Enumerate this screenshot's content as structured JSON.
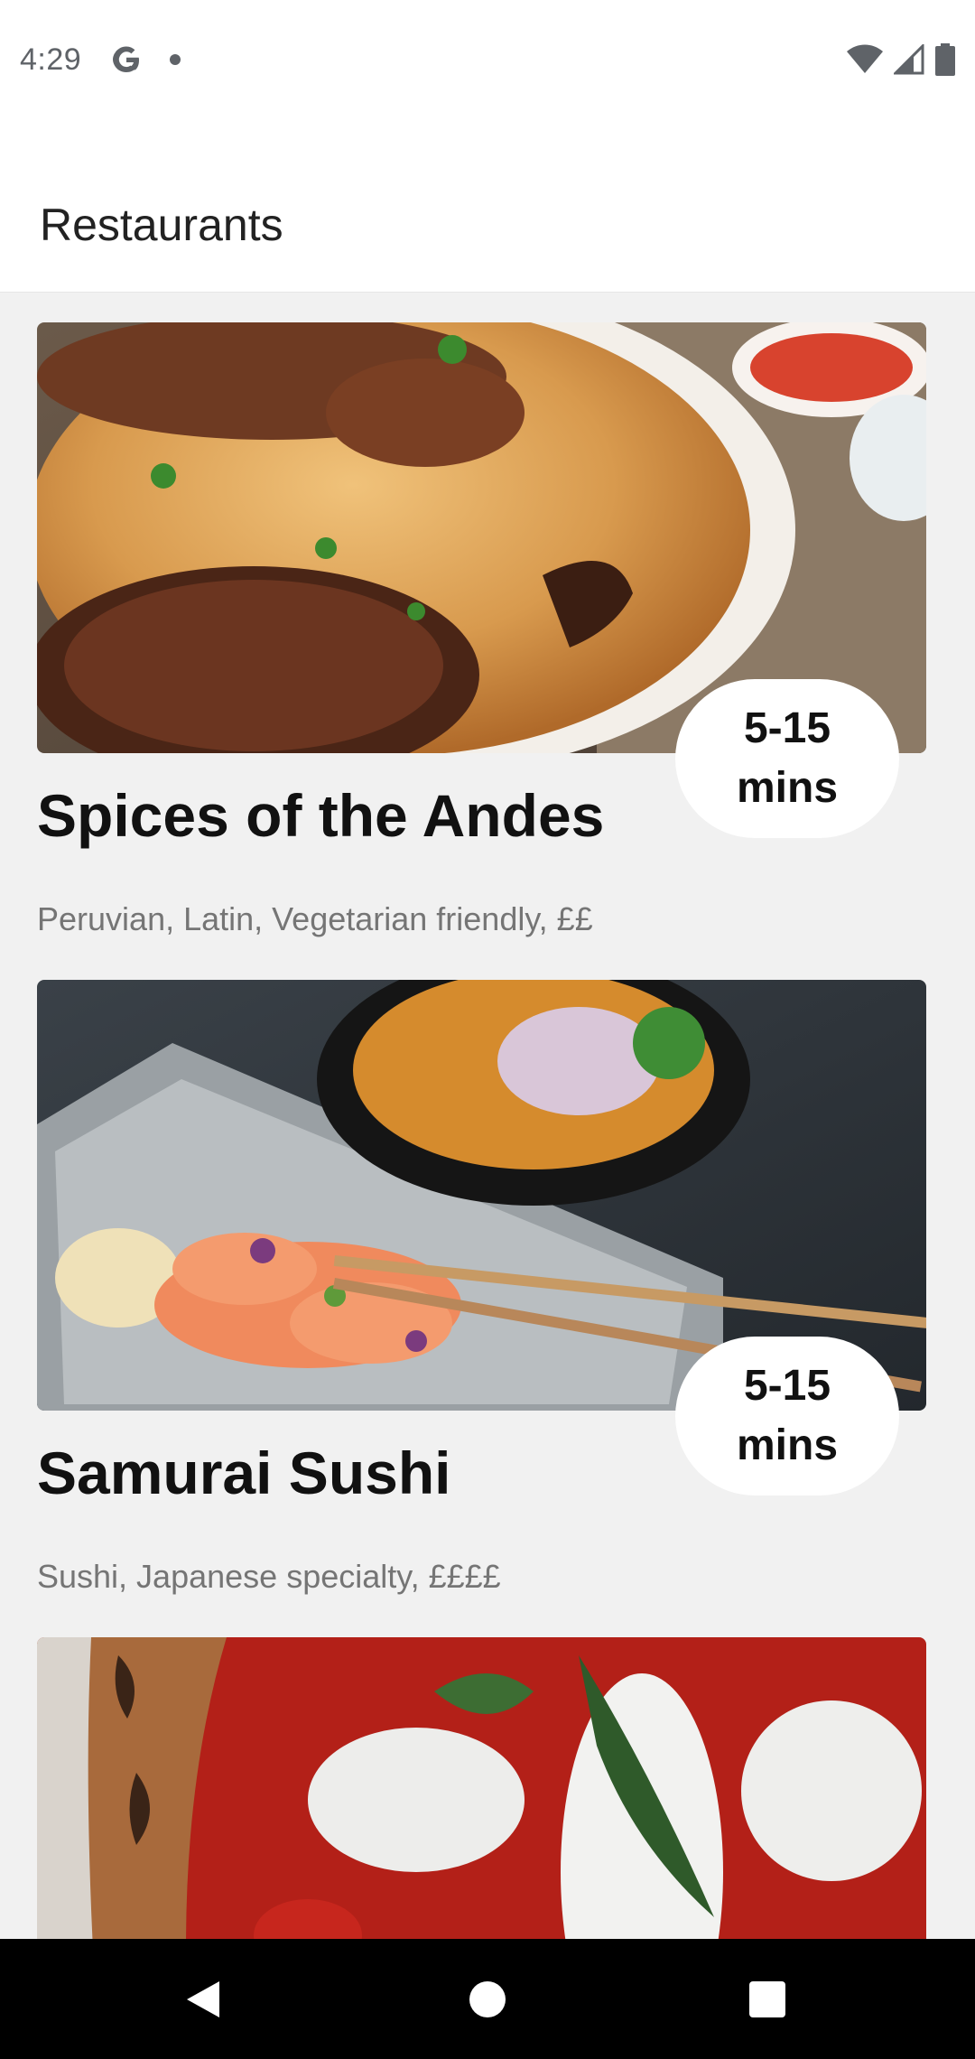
{
  "status_bar": {
    "time": "4:29",
    "icons": [
      "google-icon",
      "notification-dot-icon",
      "wifi-icon",
      "cell-signal-icon",
      "battery-icon"
    ]
  },
  "app_bar": {
    "title": "Restaurants"
  },
  "restaurants": [
    {
      "name": "Spices of the Andes",
      "tags": "Peruvian, Latin, Vegetarian friendly, ££",
      "time_value": "5-15",
      "time_unit": "mins",
      "image": "chicken-and-rice-photo"
    },
    {
      "name": "Samurai Sushi",
      "tags": "Sushi, Japanese specialty, ££££",
      "time_value": "5-15",
      "time_unit": "mins",
      "image": "salmon-sashimi-and-curry-photo"
    },
    {
      "name": "",
      "tags": "",
      "time_value": "",
      "time_unit": "",
      "image": "margherita-pizza-photo"
    }
  ],
  "nav_bar": {
    "buttons": [
      "back-icon",
      "home-icon",
      "recents-icon"
    ]
  },
  "colors": {
    "background": "#f1f1f1",
    "surface": "#ffffff",
    "nav": "#000000",
    "secondary_text": "#757575"
  }
}
